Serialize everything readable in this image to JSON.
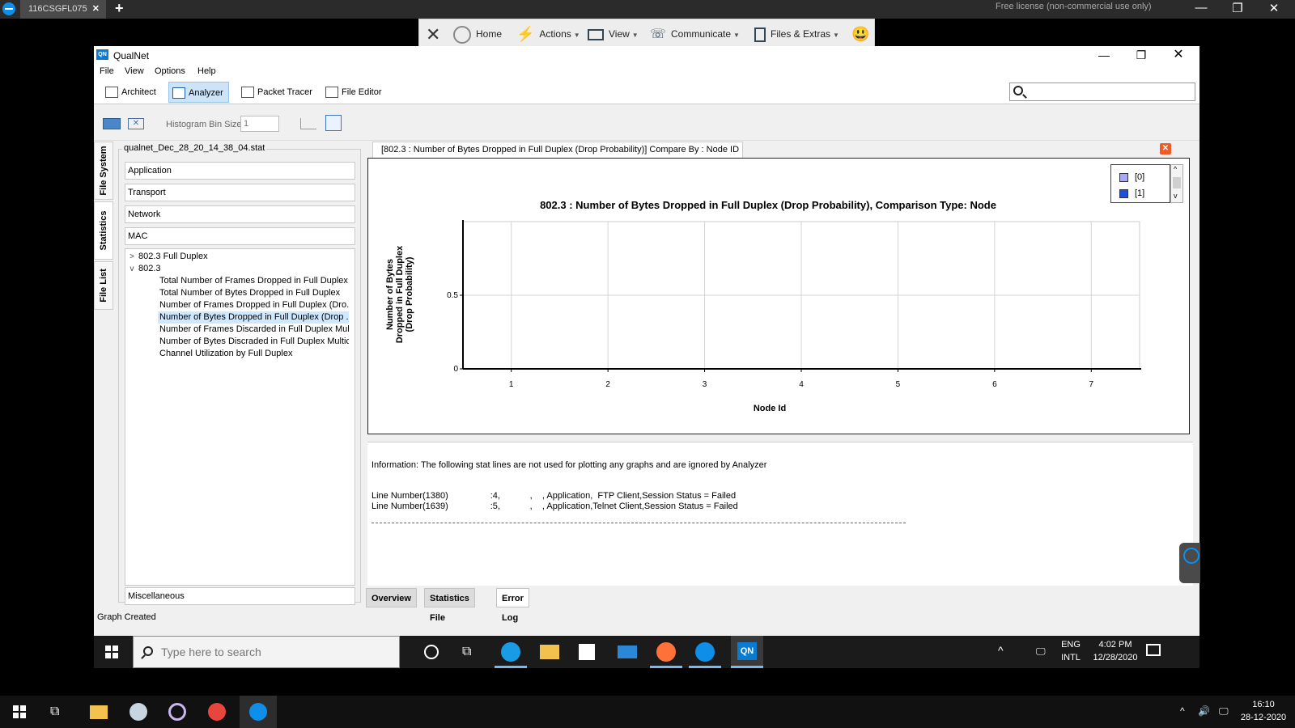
{
  "remote_session": {
    "tab_label": "116CSGFL075",
    "license_notice": "Free license (non-commercial use only)"
  },
  "tv_toolbar": {
    "home": "Home",
    "actions": "Actions",
    "view": "View",
    "communicate": "Communicate",
    "files_extras": "Files & Extras"
  },
  "window": {
    "title": "QualNet"
  },
  "menu": [
    "File",
    "View",
    "Options",
    "Help"
  ],
  "perspectives": {
    "architect": "Architect",
    "analyzer": "Analyzer",
    "packet_tracer": "Packet Tracer",
    "file_editor": "File Editor"
  },
  "toolbar": {
    "histogram_label": "Histogram Bin Size",
    "histogram_value": "1"
  },
  "side_tabs": {
    "file_system": "File System",
    "statistics": "Statistics",
    "file_list": "File List"
  },
  "stats_panel": {
    "file_name": "qualnet_Dec_28_20_14_38_04.stat",
    "categories": [
      "Application",
      "Transport",
      "Network",
      "MAC"
    ],
    "misc": "Miscellaneous",
    "tree": {
      "node1": "802.3 Full Duplex",
      "node2": "802.3",
      "leaves": [
        "Total Number of Frames Dropped in Full Duplex",
        "Total Number of Bytes Dropped in Full Duplex",
        "Number of Frames Dropped in Full Duplex (Dro...",
        "Number of Bytes Dropped in Full Duplex (Drop ...",
        "Number of Frames Discarded in Full Duplex Mul...",
        "Number of Bytes Discraded in Full Duplex Multic...",
        "Channel Utilization by Full Duplex"
      ]
    }
  },
  "graph": {
    "tab_label": "[802.3 :  Number of Bytes Dropped in Full Duplex (Drop Probability)] Compare By : Node ID",
    "legend": [
      {
        "label": "[0]",
        "color": "#a9a9f5"
      },
      {
        "label": "[1]",
        "color": "#1f4fe0"
      }
    ]
  },
  "chart_data": {
    "type": "bar",
    "title": "802.3 :  Number of Bytes Dropped in Full Duplex (Drop Probability), Comparison Type: Node",
    "xlabel": "Node Id",
    "ylabel": "Number of Bytes Dropped in Full Duplex (Drop Probability)",
    "ylabel_lines": [
      "Number of Bytes",
      "Dropped in Full Duplex",
      "(Drop Probability)"
    ],
    "categories": [
      "1",
      "2",
      "3",
      "4",
      "5",
      "6",
      "7"
    ],
    "xlim": [
      0.5,
      7.5
    ],
    "ylim": [
      0,
      1
    ],
    "yticks": [
      "0.5",
      "0"
    ],
    "ytick_values": [
      0.5,
      0
    ],
    "grid": true,
    "legend_position": "top-right",
    "series": [
      {
        "name": "[0]",
        "values": [
          0,
          0,
          0,
          0,
          0,
          0,
          0
        ]
      },
      {
        "name": "[1]",
        "values": [
          0,
          0,
          0,
          0,
          0,
          0,
          0
        ]
      }
    ]
  },
  "info": {
    "message": "Information: The following stat lines are not used for plotting any graphs and are ignored by Analyzer",
    "lines": [
      "Line Number(1380)                 :4,            ,    , Application,  FTP Client,Session Status = Failed",
      "Line Number(1639)                 :5,            ,    , Application,Telnet Client,Session Status = Failed"
    ]
  },
  "bottom_tabs": [
    "Overview",
    "Statistics File",
    "Error Log"
  ],
  "status": "Graph Created",
  "remote_taskbar": {
    "search_placeholder": "Type here to search",
    "lang": "ENG",
    "layout": "INTL",
    "time": "4:02 PM",
    "date": "12/28/2020"
  },
  "host_taskbar": {
    "time": "16:10",
    "date": "28-12-2020"
  },
  "colors": {
    "accent": "#0e8ee9",
    "selected_row": "#cde8ff",
    "close_badge": "#f15a24"
  }
}
